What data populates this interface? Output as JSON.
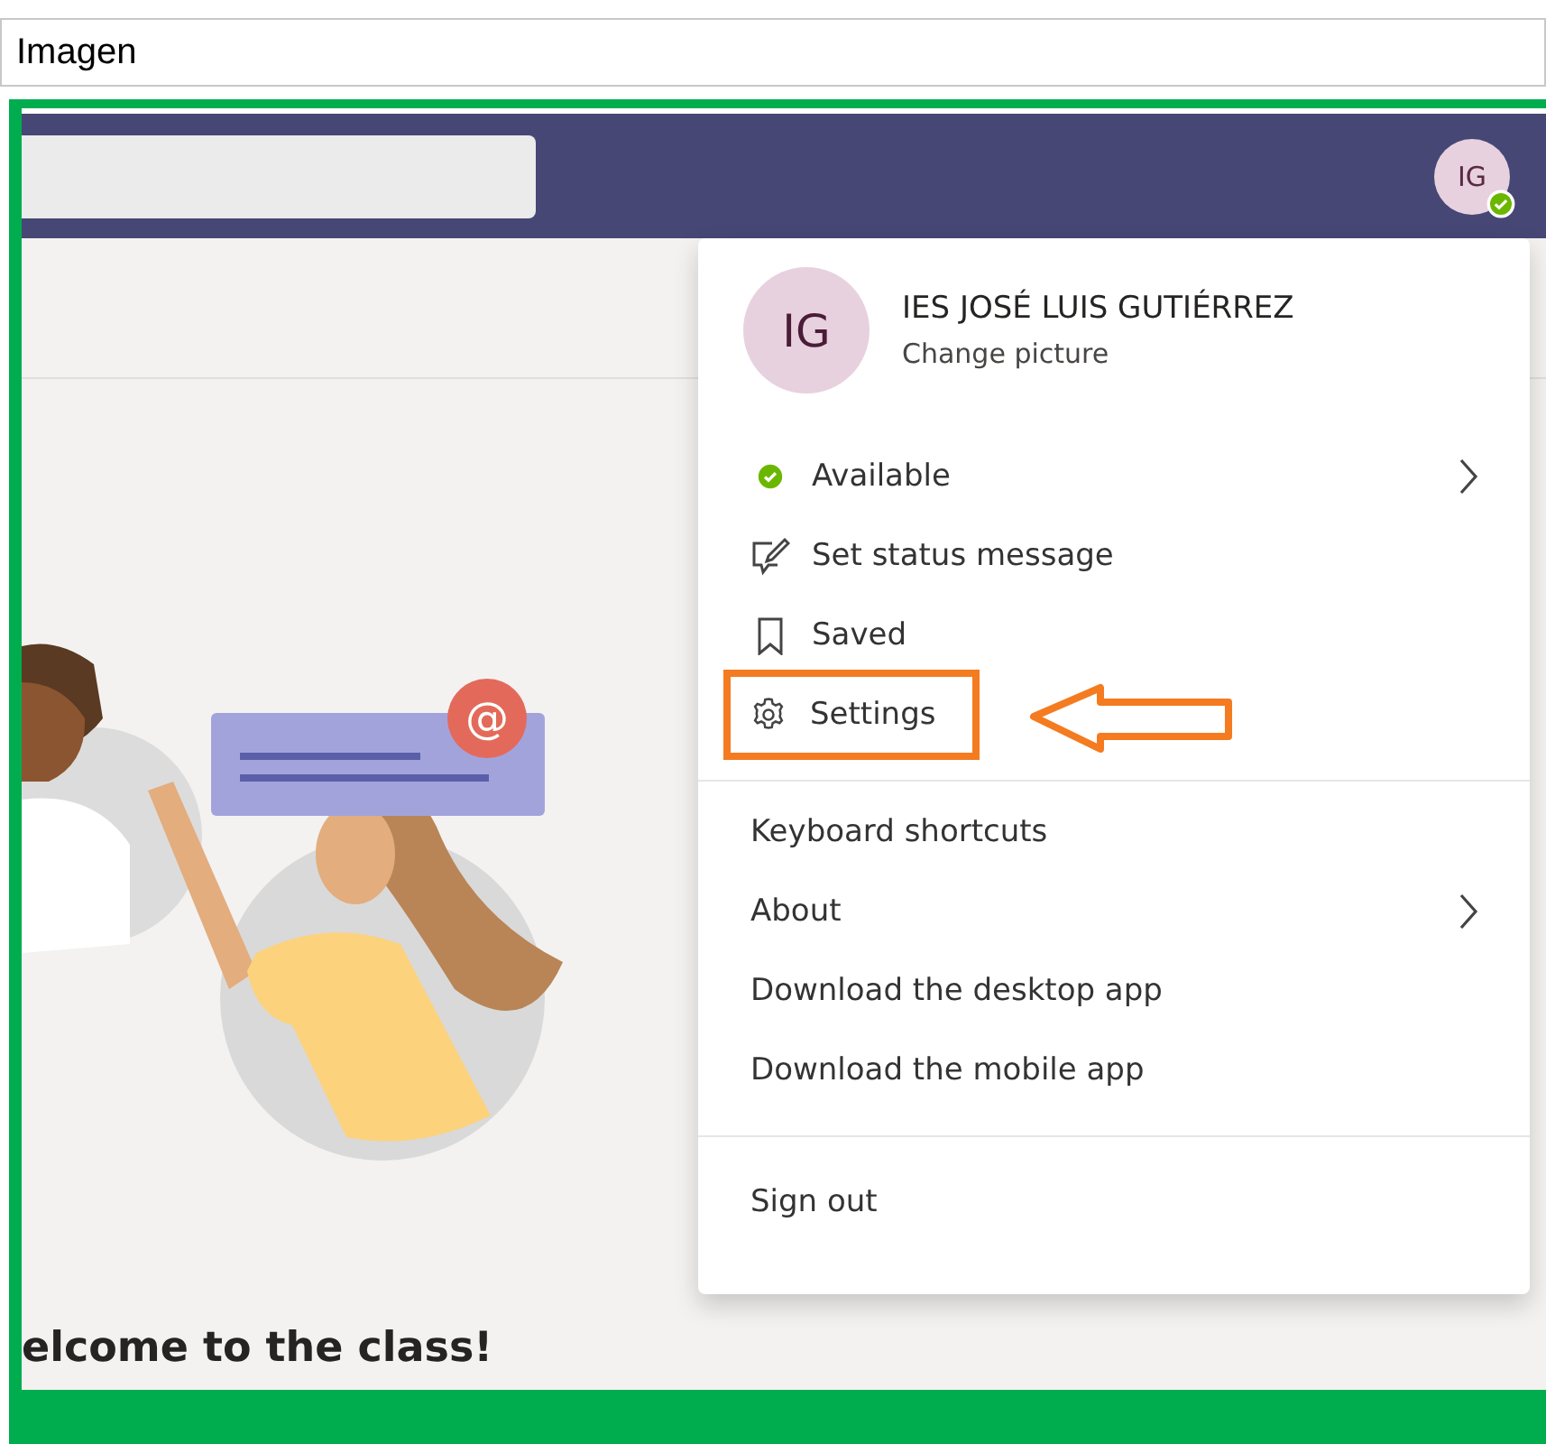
{
  "caption": "Imagen",
  "top_bar": {
    "avatar_initials": "IG",
    "presence_available": true
  },
  "welcome": {
    "heading": "elcome to the class!",
    "mention_badge": "@"
  },
  "menu": {
    "profile": {
      "initials": "IG",
      "name": "IES JOSÉ LUIS GUTIÉRREZ",
      "link": "Change picture"
    },
    "sections": [
      {
        "items": [
          {
            "kind": "status",
            "label": "Available",
            "color": "#6bb700",
            "submenu": true,
            "highlighted": false
          },
          {
            "kind": "edit",
            "label": "Set status message",
            "submenu": false,
            "highlighted": false
          },
          {
            "kind": "bookmark",
            "label": "Saved",
            "submenu": false,
            "highlighted": false
          },
          {
            "kind": "gear",
            "label": "Settings",
            "submenu": false,
            "highlighted": true
          }
        ]
      },
      {
        "items": [
          {
            "kind": "plain",
            "label": "Keyboard shortcuts",
            "submenu": false,
            "highlighted": false
          },
          {
            "kind": "plain",
            "label": "About",
            "submenu": true,
            "highlighted": false
          },
          {
            "kind": "plain",
            "label": "Download the desktop app",
            "submenu": false,
            "highlighted": false
          },
          {
            "kind": "plain",
            "label": "Download the mobile app",
            "submenu": false,
            "highlighted": false
          }
        ]
      },
      {
        "items": [
          {
            "kind": "plain",
            "label": "Sign out",
            "submenu": false,
            "highlighted": false
          }
        ]
      }
    ]
  }
}
